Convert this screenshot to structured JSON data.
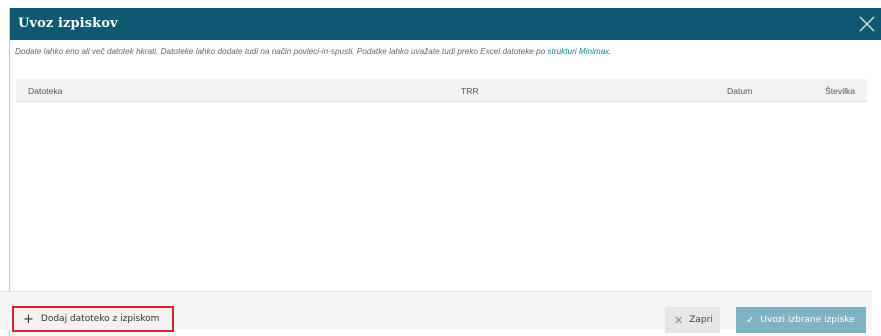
{
  "dialog": {
    "title": "Uvoz izpiskov",
    "close_icon": "close-icon"
  },
  "intro": {
    "text": "Dodate lahko eno ali več datotek hkrati. Datoteke lahko dodate tudi na način povleci-in-spusti. Podatke lahko uvažate tudi preko Excel datoteke po ",
    "link_text": "strukturi Minimax",
    "suffix": "."
  },
  "table": {
    "columns": {
      "file": "Datoteka",
      "trr": "TRR",
      "date": "Datum",
      "number": "Številka"
    },
    "rows": []
  },
  "footer": {
    "add_button": "Dodaj datoteko z izpiskom",
    "close_button": "Zapri",
    "import_button": "Uvozi izbrane izpiske"
  },
  "colors": {
    "header": "#0e5872",
    "link": "#1a7e9a",
    "highlight": "#d9232a",
    "import_button": "#7fb3c4"
  }
}
